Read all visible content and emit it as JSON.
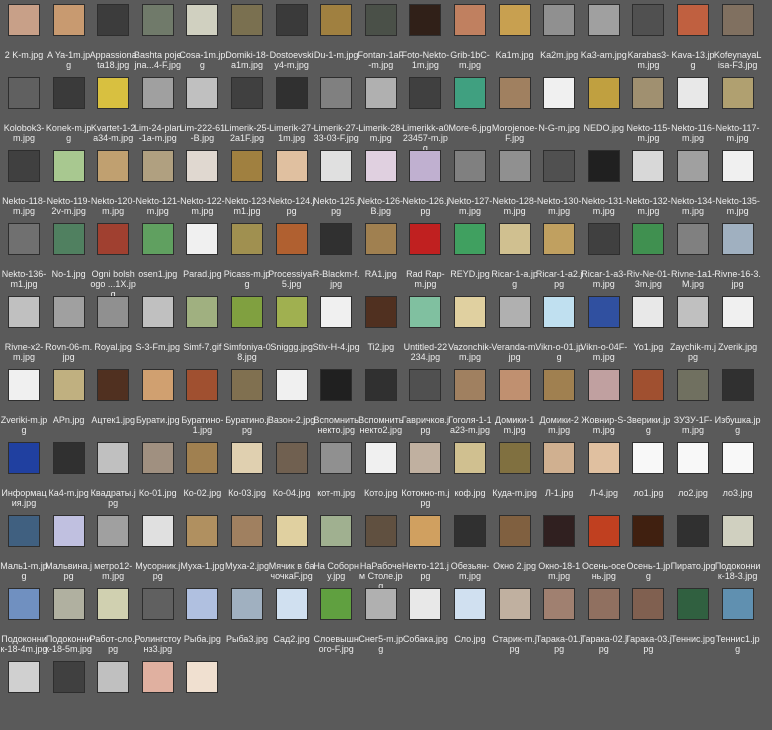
{
  "rows": [
    [
      "2 K-m.jpg",
      "A Ya-1m.jpg",
      "Appassionata18.jpg",
      "Bashta pojejna...4-F.jpg",
      "Cosa-1m.jpg",
      "Domiki-18-a1m.jpg",
      "Dostoevskiy4-m.jpg",
      "Du-1-m.jpg",
      "Fontan-1aF-m.jpg",
      "Foto-Nekto-1m.jpg",
      "Grib-1bC-m.jpg",
      "Ka1m.jpg",
      "Ka2m.jpg",
      "Ka3-am.jpg",
      "Karabas3-m.jpg",
      "Kava-13.jpg",
      "KofeynayaLisa-F3.jpg"
    ],
    [
      "Kolobok3-m.jpg",
      "Konek-m.jpg",
      "Kvartet-1-2a34-m.jpg",
      "Lim-24-plan-1a-m.jpg",
      "Lim-222-61-B.jpg",
      "Limerik-25-2a1F.jpg",
      "Limerik-27-1m.jpg",
      "Limerik-27-33-03-F.jpg",
      "Limerik-28-m.jpg",
      "Limerikk-a023457-m.jpg",
      "More-6.jpg",
      "Morojenoe-F.jpg",
      "N-G-m.jpg",
      "NEDO.jpg",
      "Nekto-115-m.jpg",
      "Nekto-116-m.jpg",
      "Nekto-117-m.jpg"
    ],
    [
      "Nekto-118-m.jpg",
      "Nekto-119-2v-m.jpg",
      "Nekto-120-m.jpg",
      "Nekto-121-m.jpg",
      "Nekto-122-m.jpg",
      "Nekto-123-m1.jpg",
      "Nekto-124.jpg",
      "Nekto-125.jpg",
      "Nekto-126-B.jpg",
      "Nekto-126.jpg",
      "Nekto-127-m.jpg",
      "Nekto-128-m.jpg",
      "Nekto-130-m.jpg",
      "Nekto-131-m.jpg",
      "Nekto-132-m.jpg",
      "Nekto-134-m.jpg",
      "Nekto-135-m.jpg"
    ],
    [
      "Nekto-136-m1.jpg",
      "No-1.jpg",
      "Ogni bolshogo ...1X.jpg",
      "osen1.jpg",
      "Parad.jpg",
      "Picass-m.jpg",
      "Processiya-5.jpg",
      "R-Blackm-f.jpg",
      "RA1.jpg",
      "Rad Rap-m.jpg",
      "REYD.jpg",
      "Ricar-1-a.jpg",
      "Ricar-1-a2.jpg",
      "Ricar-1-a3-m.jpg",
      "Riv-Ne-01-3m.jpg",
      "Rivne-1a1-M.jpg",
      "Rivne-16-3.jpg"
    ],
    [
      "Rivne-x2-m.jpg",
      "Rovn-06-m.jpg",
      "Royal.jpg",
      "S-3-Fm.jpg",
      "Simf-7.gif",
      "Simfoniya-08.jpg",
      "Sniggg.jpg",
      "Stiv-H-4.jpg",
      "Ti2.jpg",
      "Untitled-22234.jpg",
      "Vazonchik-m.jpg",
      "Veranda-m.jpg",
      "Vikn-o-01.jpg",
      "Vikn-o-04F-m.jpg",
      "Yo1.jpg",
      "Zaychik-m.jpg",
      "Zverik.jpg"
    ],
    [
      "Zveriki-m.jpg",
      "APn.jpg",
      "Ацтек1.jpg",
      "Бурати.jpg",
      "Буратино-1.jpg",
      "Буратино.jpg",
      "Вазон-2.jpg",
      "Вспомнить некто.jpg",
      "Вспомнить некто2.jpg",
      "Гавричков.jpg",
      "Гоголя-1-1a23-m.jpg",
      "Домики-1m.jpg",
      "Домики-2m.jpg",
      "Жовнир-S-m.jpg",
      "Зверики.jpg",
      "ЗУЗУ-1F-m.jpg",
      "Избушка.jpg"
    ],
    [
      "Информация.jpg",
      "Ка4-m.jpg",
      "Квадраты.jpg",
      "Ко-01.jpg",
      "Ко-02.jpg",
      "Ко-03.jpg",
      "Ко-04.jpg",
      "кот-m.jpg",
      "Кото.jpg",
      "Котокно-m.jpg",
      "коф.jpg",
      "Куда-m.jpg",
      "Л-1.jpg",
      "Л-4.jpg",
      "ло1.jpg",
      "ло2.jpg",
      "ло3.jpg"
    ],
    [
      "Маль1-m.jpg",
      "Мальвина.jpg",
      "метро12-m.jpg",
      "Мусорник.jpg",
      "Муха-1.jpg",
      "Муха-2.jpg",
      "Мячик в бачочкаF.jpg",
      "На Соборну.jpg",
      "НаРабочем Столе.jpg",
      "Некто-121.jpg",
      "Обезьян-m.jpg",
      "Окно 2.jpg",
      "Окно-18-1m.jpg",
      "Осень-осень.jpg",
      "Осень-1.jpg",
      "Пирато.jpg",
      "Подоконник-18-3.jpg"
    ],
    [
      "Подоконник-18-4m.jpg",
      "Подоконник-18-5m.jpg",
      "Работ-сло.jpg",
      "Ролингстоунз3.jpg",
      "Рыба.jpg",
      "Рыба3.jpg",
      "Сад2.jpg",
      "Слоевышного-F.jpg",
      "Снег5-m.jpg",
      "Собака.jpg",
      "Сло.jpg",
      "Старик-m.jpg",
      "Тарака-01.jpg",
      "Тарака-02.jpg",
      "Тарака-03.jpg",
      "Теннис.jpg",
      "Теннис1.jpg"
    ],
    [
      "",
      "",
      "",
      "",
      ""
    ]
  ],
  "thumb_colors": [
    [
      "#c8a088",
      "#c89a70",
      "#3c3c3c",
      "#707a6a",
      "#d0d0c0",
      "#7a7050",
      "#3a3a3a",
      "#a08040",
      "#4a5048",
      "#302018",
      "#c08060",
      "#c8a050",
      "#909090",
      "#a0a0a0",
      "#505050",
      "#c06040",
      "#807060"
    ],
    [
      "#606060",
      "#3a3a3a",
      "#d8c040",
      "#a0a0a0",
      "#c0c0c0",
      "#404040",
      "#303030",
      "#808080",
      "#b0b0b0",
      "#404040",
      "#40a080",
      "#a08060",
      "#f0f0f0",
      "#c0a040",
      "#a09070",
      "#e8e8e8",
      "#b0a070"
    ],
    [
      "#404040",
      "#a8c890",
      "#c0a070",
      "#b0a080",
      "#e0d8d0",
      "#a08040",
      "#e0c0a0",
      "#e0e0e0",
      "#e0d0e0",
      "#c0b0d0",
      "#808080",
      "#909090",
      "#505050",
      "#202020",
      "#d8d8d8",
      "#a0a0a0",
      "#f0f0f0"
    ],
    [
      "#707070",
      "#508060",
      "#a04030",
      "#60a060",
      "#f0f0f0",
      "#a09050",
      "#b06030",
      "#303030",
      "#a08050",
      "#c02020",
      "#40a060",
      "#d0c090",
      "#c0a060",
      "#404040",
      "#409050",
      "#808080",
      "#a0b0c0"
    ],
    [
      "#c0c0c0",
      "#a0a0a0",
      "#909090",
      "#c0c0c0",
      "#a0b080",
      "#80a040",
      "#a0b050",
      "#f0f0f0",
      "#503020",
      "#80c0a0",
      "#e0d0a0",
      "#b0b0b0",
      "#c0e0f0",
      "#3050a0",
      "#e8e8e8",
      "#c0c0c0",
      "#f0f0f0"
    ],
    [
      "#f0f0f0",
      "#c0b080",
      "#503020",
      "#d0a070",
      "#a05030",
      "#807050",
      "#f0f0f0",
      "#202020",
      "#303030",
      "#505050",
      "#a08060",
      "#c09070",
      "#a08050",
      "#c0a0a0",
      "#a05030",
      "#707060",
      "#303030"
    ],
    [
      "#2040a0",
      "#303030",
      "#c0c0c0",
      "#a09080",
      "#a08050",
      "#e0d0b0",
      "#706050",
      "#909090",
      "#f0f0f0",
      "#c0b0a0",
      "#d0c090",
      "#807040",
      "#d0b090",
      "#e0c0a0",
      "#f8f8f8",
      "#f8f8f8",
      "#f8f8f8"
    ],
    [
      "#406080",
      "#c0c0e0",
      "#a0a0a0",
      "#e0e0e0",
      "#b09060",
      "#a08060",
      "#e0d0a0",
      "#a0b090",
      "#605040",
      "#d0a060",
      "#303030",
      "#806040",
      "#302020",
      "#c04020",
      "#402010",
      "#303030",
      "#d0d0c0"
    ],
    [
      "#7090c0",
      "#b0b0a0",
      "#d0d0b0",
      "#606060",
      "#b0c0e0",
      "#a0b0c0",
      "#d0e0f0",
      "#60a040",
      "#b0b0b0",
      "#e8e8e8",
      "#d0e0f0",
      "#c0b0a0",
      "#a08070",
      "#907060",
      "#806050",
      "#306040",
      "#6090b0"
    ],
    [
      "#d0d0d0",
      "#404040",
      "#c0c0c0",
      "#e0b0a0",
      "#f0e0d0"
    ]
  ]
}
